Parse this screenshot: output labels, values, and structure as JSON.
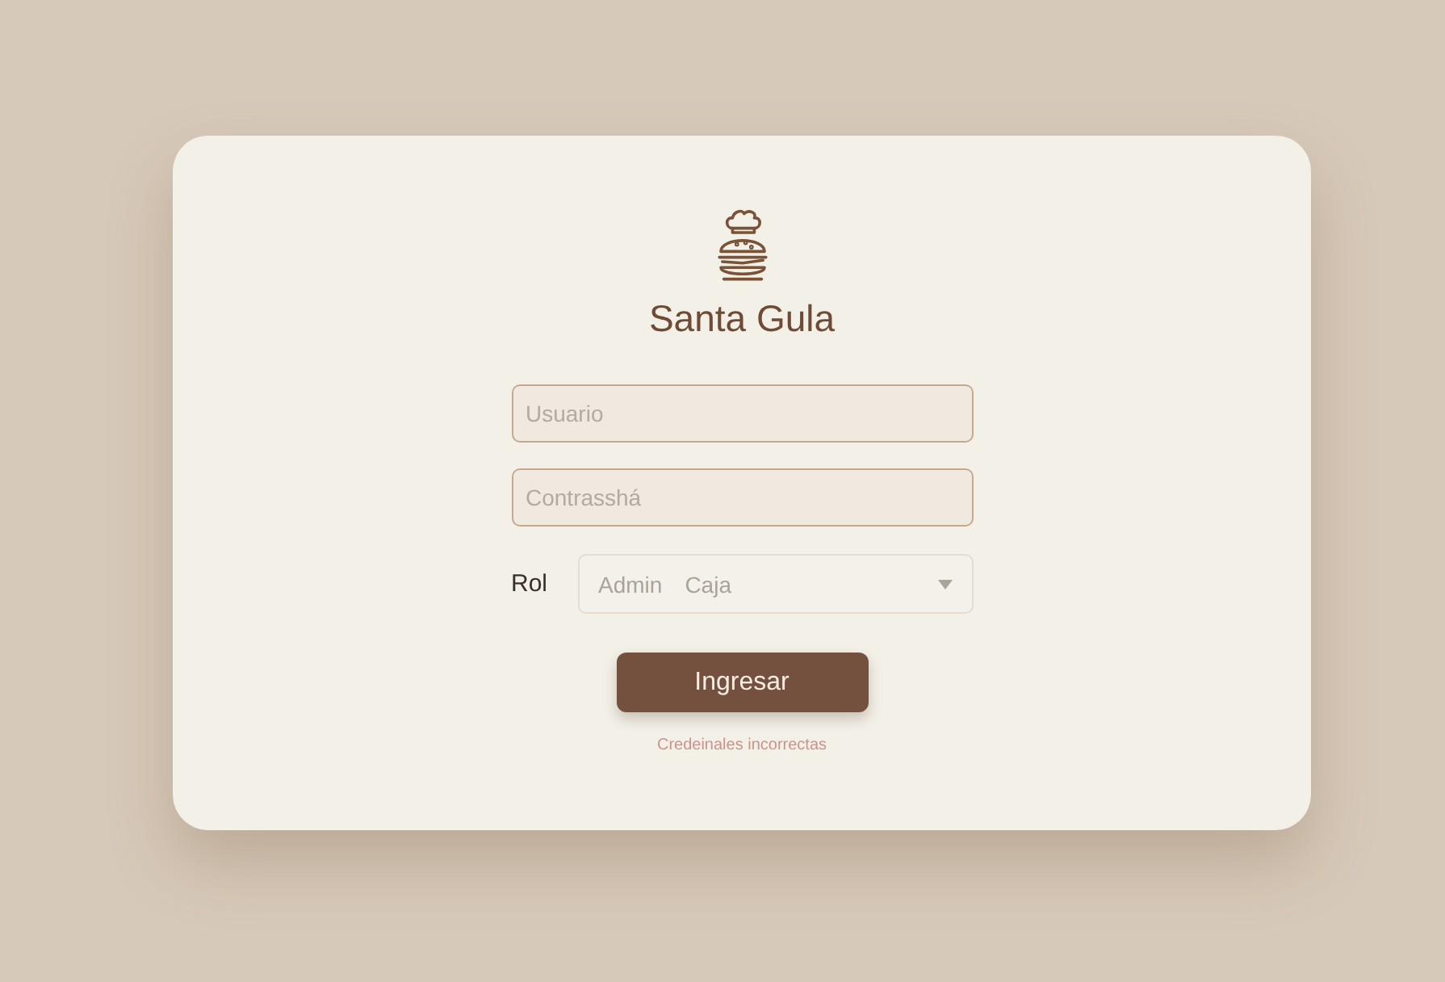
{
  "brand": {
    "title": "Santa Gula"
  },
  "fields": [
    {
      "placeholder": "Usuario"
    },
    {
      "placeholder": "Contrasshá"
    }
  ],
  "role": {
    "label": "Rol",
    "options": [
      "Admin",
      "Caja"
    ]
  },
  "submit": {
    "label": "Ingresar"
  },
  "error": "Credeinales incorrectas"
}
